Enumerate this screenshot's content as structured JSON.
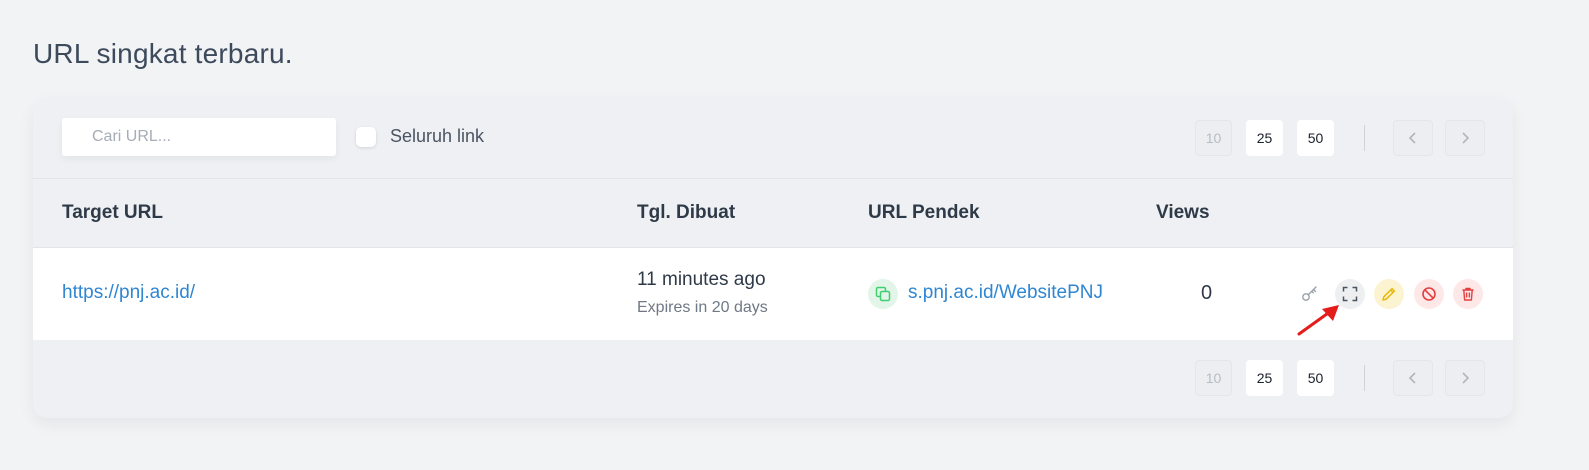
{
  "page_title": "URL singkat terbaru.",
  "toolbar": {
    "search_placeholder": "Cari URL...",
    "search_value": "",
    "all_links_label": "Seluruh link",
    "all_links_checked": false
  },
  "pagination": {
    "sizes": [
      "10",
      "25",
      "50"
    ],
    "current_size": "10",
    "prev_icon": "chevron-left-icon",
    "next_icon": "chevron-right-icon"
  },
  "table": {
    "headers": {
      "target_url": "Target URL",
      "created": "Tgl. Dibuat",
      "short_url": "URL Pendek",
      "views": "Views"
    },
    "rows": [
      {
        "target_url": "https://pnj.ac.id/",
        "created": "11 minutes ago",
        "expires": "Expires in 20 days",
        "short_url": "s.pnj.ac.id/WebsitePNJ",
        "views": "0",
        "actions": [
          "key-icon",
          "qr-code-icon",
          "edit-pencil-icon",
          "ban-icon",
          "trash-icon"
        ]
      }
    ]
  },
  "colors": {
    "link": "#2f86d2",
    "copy_icon": "#3ecf6e",
    "edit_icon": "#e8b80c",
    "danger_icon": "#e53e3e",
    "annotation_arrow": "#e51c1c"
  }
}
